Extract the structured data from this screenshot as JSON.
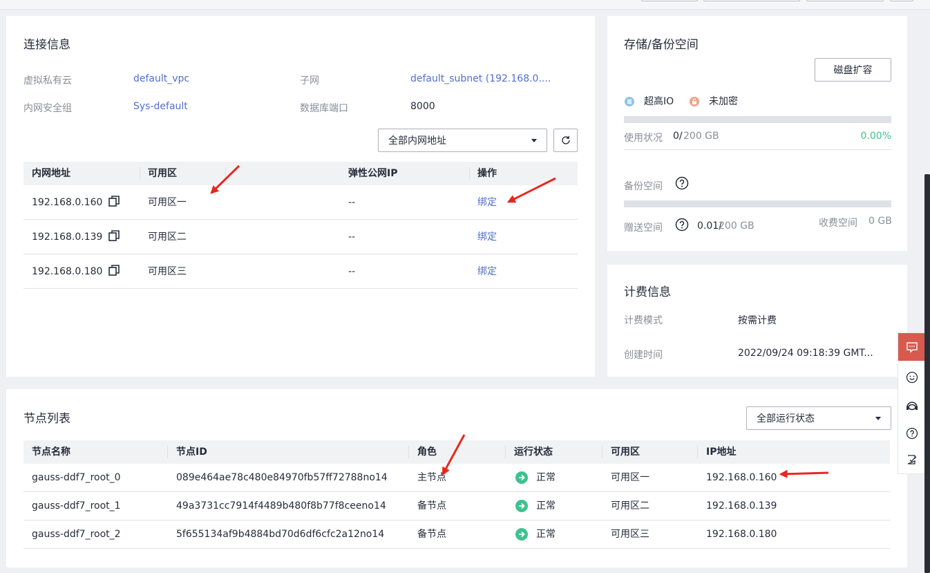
{
  "connection": {
    "title": "连接信息",
    "vpc_label": "虚拟私有云",
    "vpc_value": "default_vpc",
    "subnet_label": "子网",
    "subnet_value": "default_subnet (192.168.0....",
    "sg_label": "内网安全组",
    "sg_value": "Sys-default",
    "port_label": "数据库端口",
    "port_value": "8000",
    "filter_value": "全部内网地址",
    "columns": [
      "内网地址",
      "可用区",
      "弹性公网IP",
      "操作"
    ],
    "rows": [
      {
        "ip": "192.168.0.160",
        "az": "可用区一",
        "eip": "--",
        "action": "绑定"
      },
      {
        "ip": "192.168.0.139",
        "az": "可用区二",
        "eip": "--",
        "action": "绑定"
      },
      {
        "ip": "192.168.0.180",
        "az": "可用区三",
        "eip": "--",
        "action": "绑定"
      }
    ]
  },
  "storage": {
    "title": "存储/备份空间",
    "expand_button": "磁盘扩容",
    "disk_type": "超高IO",
    "encryption": "未加密",
    "usage_label": "使用状况",
    "usage_used": "0/",
    "usage_total": "200 GB",
    "usage_percent": "0.00%",
    "usage_fraction": 0,
    "backup_label": "备份空间",
    "free_label": "赠送空间",
    "free_used": "0.01/",
    "free_total": "200 GB",
    "paid_label": "收费空间",
    "paid_value": "0 GB"
  },
  "billing": {
    "title": "计费信息",
    "mode_label": "计费模式",
    "mode_value": "按需计费",
    "created_label": "创建时间",
    "created_value": "2022/09/24 09:18:39 GMT..."
  },
  "nodes": {
    "title": "节点列表",
    "filter_value": "全部运行状态",
    "columns": [
      "节点名称",
      "节点ID",
      "角色",
      "运行状态",
      "可用区",
      "IP地址"
    ],
    "rows": [
      {
        "name": "gauss-ddf7_root_0",
        "id": "089e464ae78c480e84970fb57ff72788no14",
        "role": "主节点",
        "status": "正常",
        "az": "可用区一",
        "ip": "192.168.0.160"
      },
      {
        "name": "gauss-ddf7_root_1",
        "id": "49a3731cc7914f4489b480f8b77f8ceeno14",
        "role": "备节点",
        "status": "正常",
        "az": "可用区二",
        "ip": "192.168.0.139"
      },
      {
        "name": "gauss-ddf7_root_2",
        "id": "5f655134af9b4884bd70d6df6cfc2a12no14",
        "role": "备节点",
        "status": "正常",
        "az": "可用区三",
        "ip": "192.168.0.180"
      }
    ]
  },
  "colors": {
    "link": "#526ecc",
    "success": "#3ec28f",
    "arrow": "#e6281e",
    "accent": "#d85a4f"
  }
}
